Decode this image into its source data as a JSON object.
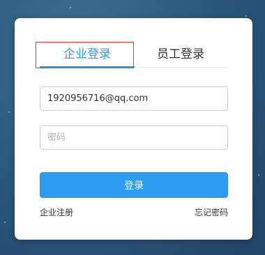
{
  "tabs": {
    "company_login": "企业登录",
    "employee_login": "员工登录",
    "active": "company_login"
  },
  "form": {
    "email_value": "1920956716@qq.com",
    "password_placeholder": "密码",
    "login_button": "登录"
  },
  "links": {
    "register": "企业注册",
    "forgot_password": "忘记密码"
  },
  "colors": {
    "accent": "#2d9bef",
    "highlight_box": "#d63a3a",
    "background": "#2d5a80"
  }
}
